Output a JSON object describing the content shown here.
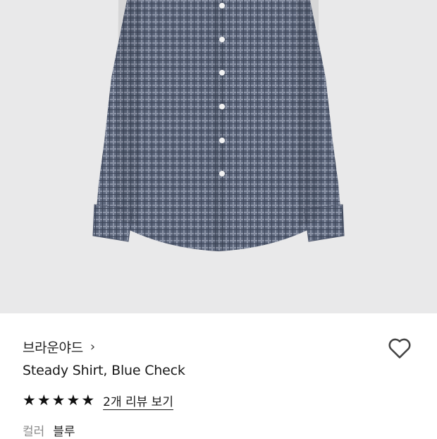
{
  "product": {
    "brand": "브라운야드",
    "brand_chevron": "›",
    "title": "Steady Shirt, Blue Check",
    "rating_stars": 5,
    "reviews_link": "2개 리뷰 보기",
    "option_label": "컬러",
    "option_value": "블루"
  },
  "icons": {
    "chevron": "chevron-right-icon",
    "wishlist": "heart-outline-icon",
    "star": "star-filled-icon"
  },
  "colors": {
    "photo_bg": "#e9e9ea",
    "shirt": "#5a6478",
    "text": "#1a1a1a",
    "muted": "#8a8a8a"
  }
}
